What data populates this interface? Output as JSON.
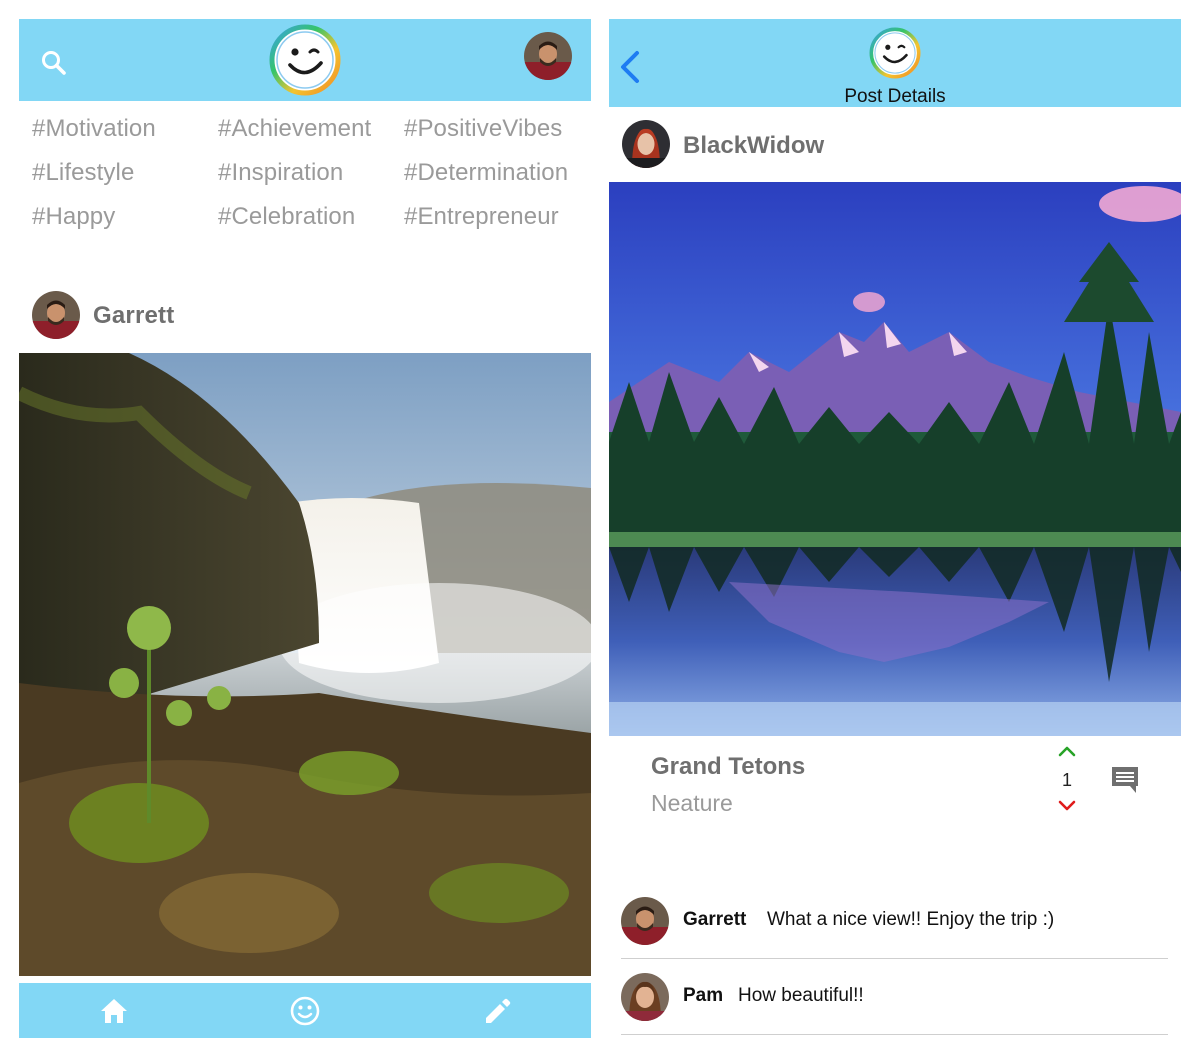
{
  "feed": {
    "header": {
      "search_icon": "search-icon",
      "logo": "smiley-logo",
      "profile_avatar": "user-avatar"
    },
    "hashtags": [
      "#Motivation",
      "#Achievement",
      "#PositiveVibes",
      "#Lifestyle",
      "#Inspiration",
      "#Determination",
      "#Happy",
      "#Celebration",
      "#Entrepreneur"
    ],
    "post": {
      "user_name": "Garrett",
      "image": "waterfall-photo"
    },
    "bottom_nav": {
      "items": [
        "home-icon",
        "smiley-icon",
        "pencil-icon"
      ]
    }
  },
  "detail": {
    "header": {
      "back_icon": "chevron-left-icon",
      "logo": "smiley-logo",
      "title": "Post Details"
    },
    "post": {
      "user_name": "BlackWidow",
      "image": "mountain-lake-photo",
      "title": "Grand Tetons",
      "category": "Neature",
      "votes": "1"
    },
    "comments": [
      {
        "user": "Garrett",
        "text": "What a nice view!! Enjoy the trip :)"
      },
      {
        "user": "Pam",
        "text": "How beautiful!!"
      }
    ]
  },
  "colors": {
    "header_bg": "#82d7f5",
    "back_arrow": "#1e7cf2",
    "upvote": "#27a327",
    "downvote": "#e01b1b",
    "muted_text": "#9a9a9a"
  }
}
